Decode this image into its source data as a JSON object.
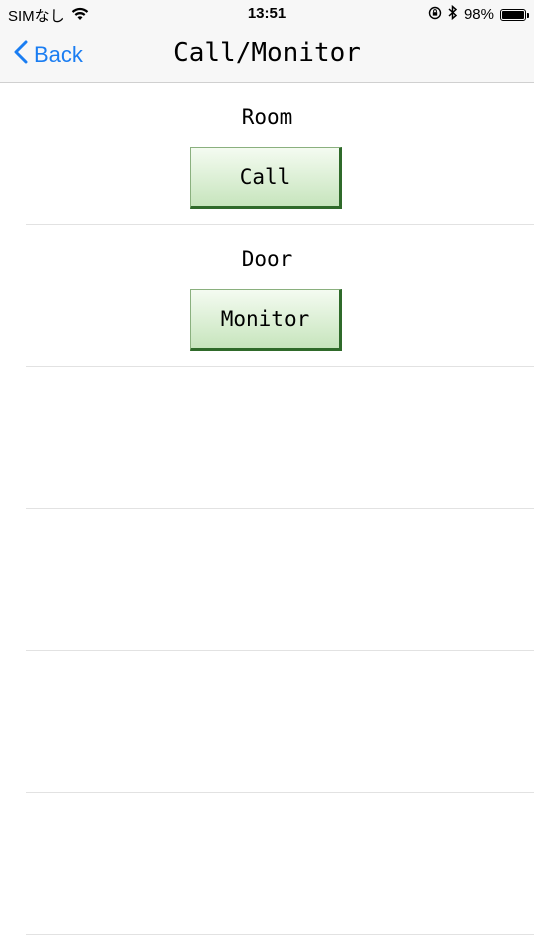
{
  "status_bar": {
    "carrier": "SIMなし",
    "time": "13:51",
    "battery_percent": "98%",
    "battery_level": 0.98,
    "icons": [
      "wifi-icon",
      "orientation-lock-icon",
      "bluetooth-icon",
      "battery-icon"
    ]
  },
  "nav": {
    "back_label": "Back",
    "title": "Call/Monitor",
    "accent_color": "#1a7df2"
  },
  "rows": [
    {
      "label": "Room",
      "button_label": "Call"
    },
    {
      "label": "Door",
      "button_label": "Monitor"
    },
    {
      "label": "",
      "button_label": ""
    },
    {
      "label": "",
      "button_label": ""
    },
    {
      "label": "",
      "button_label": ""
    },
    {
      "label": "",
      "button_label": ""
    }
  ],
  "button_colors": {
    "top": "#f4fbf1",
    "bottom": "#c7e5bd",
    "shadow": "#2f6a2a"
  }
}
